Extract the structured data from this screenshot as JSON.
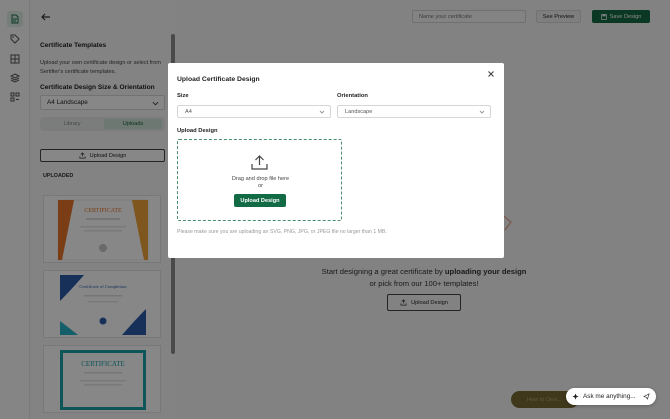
{
  "topbar": {
    "name_placeholder": "Name your certificate",
    "preview_label": "See Preview",
    "save_label": "Save Design"
  },
  "panel": {
    "title": "Certificate Templates",
    "description": "Upload your own certificate design or select from Sertifier's certificate templates.",
    "size_label": "Certificate Design Size & Orientation",
    "size_value": "A4 Landscape",
    "tabs": [
      "Library",
      "Uploads"
    ],
    "upload_label": "Upload Design",
    "uploaded_heading": "UPLOADED",
    "thumbnails": [
      {
        "heading": "CERTIFICATE",
        "accent": "#e8742a"
      },
      {
        "heading": "Certificate of Completion",
        "accent": "#2a5cab"
      },
      {
        "heading": "CERTIFICATE",
        "accent": "#1aa0a8"
      }
    ]
  },
  "canvas": {
    "text_start": "Start designing a great certificate by ",
    "text_bold": "uploading your design",
    "text_end": "or pick from our 100+ templates!",
    "upload_label": "Upload Design"
  },
  "modal": {
    "title": "Upload Certificate Design",
    "size_label": "Size",
    "size_value": "A4",
    "orientation_label": "Orientation",
    "orientation_value": "Landscape",
    "upload_label": "Upload Design",
    "drag_text": "Drag and drop file here",
    "or_text": "or",
    "button_label": "Upload Design",
    "note": "Please make sure you are uploading an SVG, PNG, JPG, or JPEG file no larger than 1 MB."
  },
  "assistant": {
    "how_label": "How to Desi...",
    "ask_label": "Ask me anything..."
  },
  "colors": {
    "brand": "#136b45",
    "overlay": "rgba(0,0,0,0.47)"
  }
}
